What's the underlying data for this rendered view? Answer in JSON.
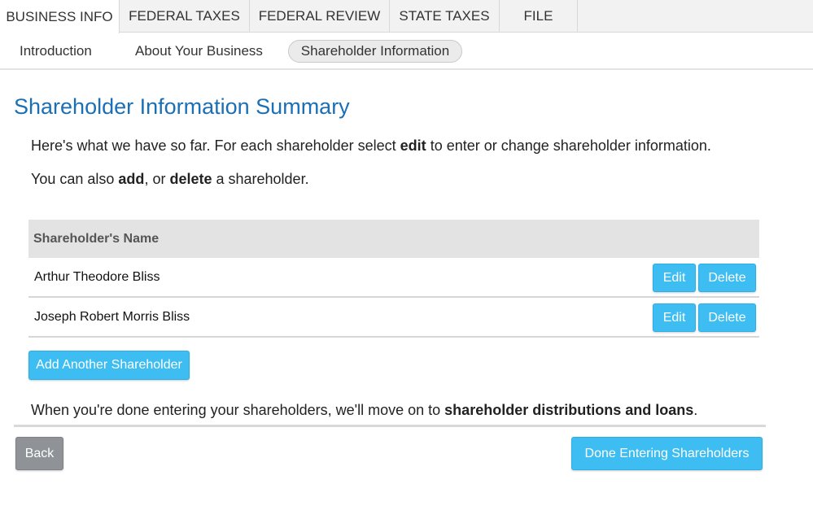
{
  "top_tabs": [
    {
      "label": "BUSINESS INFO",
      "active": true
    },
    {
      "label": "FEDERAL TAXES",
      "active": false
    },
    {
      "label": "FEDERAL REVIEW",
      "active": false
    },
    {
      "label": "STATE TAXES",
      "active": false
    },
    {
      "label": "FILE",
      "active": false
    }
  ],
  "sub_tabs": [
    {
      "label": "Introduction",
      "active": false
    },
    {
      "label": "About Your Business",
      "active": false
    },
    {
      "label": "Shareholder Information",
      "active": true
    }
  ],
  "page": {
    "title": "Shareholder Information Summary",
    "intro": {
      "part1": "Here's what we have so far. For each shareholder select ",
      "bold1": "edit",
      "part2": " to enter or change shareholder information."
    },
    "also": {
      "part1": "You can also ",
      "bold1": "add",
      "part2": ", or ",
      "bold2": "delete",
      "part3": " a shareholder."
    },
    "done_note": {
      "part1": "When you're done entering your shareholders, we'll move on to ",
      "bold1": "shareholder distributions and loans",
      "part2": "."
    }
  },
  "table": {
    "header": "Shareholder's Name",
    "rows": [
      {
        "name": "Arthur Theodore Bliss",
        "edit_label": "Edit",
        "delete_label": "Delete"
      },
      {
        "name": "Joseph Robert Morris Bliss",
        "edit_label": "Edit",
        "delete_label": "Delete"
      }
    ]
  },
  "buttons": {
    "add": "Add Another Shareholder",
    "back": "Back",
    "done": "Done Entering Shareholders"
  },
  "colors": {
    "accent": "#3dbdf2",
    "title": "#1b6fb5",
    "back_button": "#8f9296"
  }
}
